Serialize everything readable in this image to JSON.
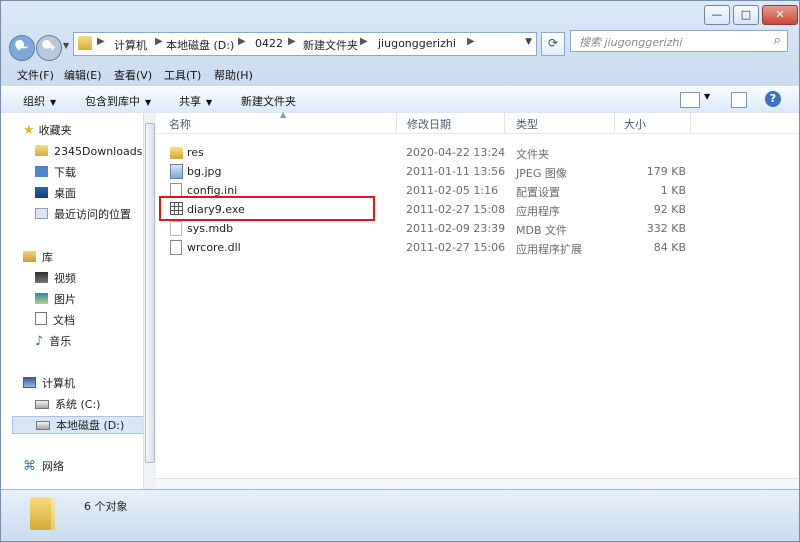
{
  "titlebar": {
    "buttons": [
      "—",
      "□",
      "✕"
    ]
  },
  "address": {
    "path": [
      "计算机",
      "本地磁盘 (D:)",
      "0422",
      "新建文件夹",
      "jiugonggerizhi"
    ]
  },
  "search": {
    "placeholder": "搜索 jiugonggerizhi"
  },
  "menu": {
    "items": [
      "文件(F)",
      "编辑(E)",
      "查看(V)",
      "工具(T)",
      "帮助(H)"
    ]
  },
  "toolbar": {
    "organize": "组织",
    "include": "包含到库中",
    "share": "共享",
    "new_folder": "新建文件夹"
  },
  "sidebar": {
    "favorites": "收藏夹",
    "favorite_items": [
      "2345Downloads",
      "下载",
      "桌面",
      "最近访问的位置"
    ],
    "libraries": "库",
    "library_items": [
      "视频",
      "图片",
      "文档",
      "音乐"
    ],
    "computer": "计算机",
    "drives": [
      "系统 (C:)",
      "本地磁盘 (D:)"
    ],
    "network": "网络"
  },
  "columns": {
    "name": "名称",
    "date": "修改日期",
    "type": "类型",
    "size": "大小"
  },
  "files": [
    {
      "name": "res",
      "date": "2020-04-22 13:24",
      "type": "文件夹",
      "size": "",
      "icon": "folder-icon"
    },
    {
      "name": "bg.jpg",
      "date": "2011-01-11 13:56",
      "type": "JPEG 图像",
      "size": "179 KB",
      "icon": "jpg-file-icon"
    },
    {
      "name": "config.ini",
      "date": "2011-02-05 1:16",
      "type": "配置设置",
      "size": "1 KB",
      "icon": "ini-file-icon"
    },
    {
      "name": "diary9.exe",
      "date": "2011-02-27 15:08",
      "type": "应用程序",
      "size": "92 KB",
      "icon": "exe-file-icon"
    },
    {
      "name": "sys.mdb",
      "date": "2011-02-09 23:39",
      "type": "MDB 文件",
      "size": "332 KB",
      "icon": "mdb-file-icon"
    },
    {
      "name": "wrcore.dll",
      "date": "2011-02-27 15:06",
      "type": "应用程序扩展",
      "size": "84 KB",
      "icon": "dll-file-icon"
    }
  ],
  "status": {
    "count": "6 个对象"
  },
  "colors": {
    "highlight": "#d71920",
    "selected_sidebar": "#d8e6f5",
    "frame": "#c7d9ee"
  }
}
